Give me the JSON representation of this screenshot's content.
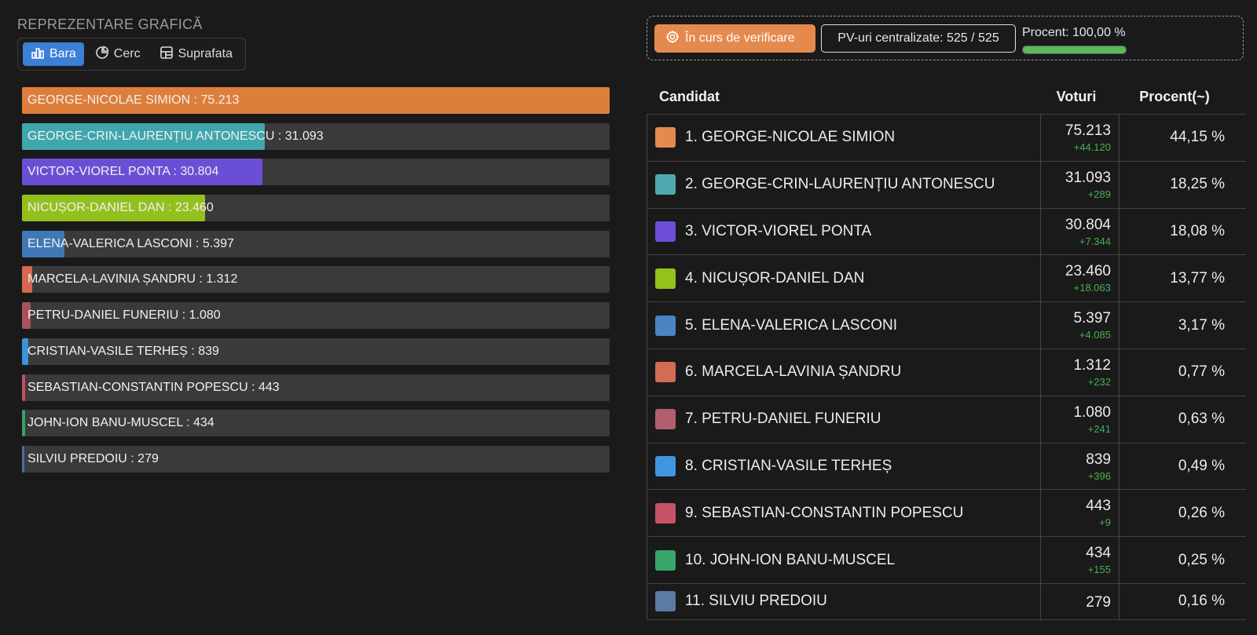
{
  "chart_section": {
    "title": "REPREZENTARE GRAFICĂ",
    "toggle": [
      {
        "label": "Bara",
        "icon": "bar-chart-icon",
        "active": true
      },
      {
        "label": "Cerc",
        "icon": "pie-chart-icon",
        "active": false
      },
      {
        "label": "Suprafata",
        "icon": "treemap-icon",
        "active": false
      }
    ]
  },
  "status": {
    "button_label": "În curs de verificare",
    "pv_label": "PV-uri centralizate: 525 / 525",
    "percent_label": "Procent: 100,00 %",
    "percent_value": 100,
    "accent_color": "#e48a4d",
    "progress_color": "#5cb85c"
  },
  "table": {
    "headers": {
      "candidate": "Candidat",
      "votes": "Voturi",
      "percent": "Procent(~)"
    }
  },
  "chart_data": {
    "type": "bar",
    "orientation": "horizontal",
    "xlim": [
      0,
      75213
    ],
    "categories": [
      "GEORGE-NICOLAE SIMION",
      "GEORGE-CRIN-LAURENȚIU ANTONESCU",
      "VICTOR-VIOREL PONTA",
      "NICUȘOR-DANIEL DAN",
      "ELENA-VALERICA LASCONI",
      "MARCELA-LAVINIA ȘANDRU",
      "PETRU-DANIEL FUNERIU",
      "CRISTIAN-VASILE TERHEȘ",
      "SEBASTIAN-CONSTANTIN POPESCU",
      "JOHN-ION BANU-MUSCEL",
      "SILVIU PREDOIU"
    ],
    "values": [
      75213,
      31093,
      30804,
      23460,
      5397,
      1312,
      1080,
      839,
      443,
      434,
      279
    ],
    "bar_labels": [
      "GEORGE-NICOLAE SIMION : 75.213",
      "GEORGE-CRIN-LAURENȚIU ANTONESCU : 31.093",
      "VICTOR-VIOREL PONTA : 30.804",
      "NICUȘOR-DANIEL DAN : 23.460",
      "ELENA-VALERICA LASCONI : 5.397",
      "MARCELA-LAVINIA ȘANDRU : 1.312",
      "PETRU-DANIEL FUNERIU : 1.080",
      "CRISTIAN-VASILE TERHEȘ : 839",
      "SEBASTIAN-CONSTANTIN POPESCU : 443",
      "JOHN-ION BANU-MUSCEL : 434",
      "SILVIU PREDOIU : 279"
    ],
    "colors": [
      "#dd7e3b",
      "#40a6ad",
      "#6a4fd6",
      "#93c01f",
      "#3f79b5",
      "#d5694f",
      "#a8525e",
      "#3d93d9",
      "#c24f62",
      "#38a067",
      "#4f6f98"
    ]
  },
  "candidates": [
    {
      "name": "1. GEORGE-NICOLAE SIMION",
      "votes": "75.213",
      "delta": "+44.120",
      "percent": "44,15 %",
      "color": "#e48a4d"
    },
    {
      "name": "2. GEORGE-CRIN-LAURENȚIU ANTONESCU",
      "votes": "31.093",
      "delta": "+289",
      "percent": "18,25 %",
      "color": "#4fa8b1"
    },
    {
      "name": "3. VICTOR-VIOREL PONTA",
      "votes": "30.804",
      "delta": "+7.344",
      "percent": "18,08 %",
      "color": "#6d4fd8"
    },
    {
      "name": "4. NICUȘOR-DANIEL DAN",
      "votes": "23.460",
      "delta": "+18.063",
      "percent": "13,77 %",
      "color": "#94c11c"
    },
    {
      "name": "5. ELENA-VALERICA LASCONI",
      "votes": "5.397",
      "delta": "+4.085",
      "percent": "3,17 %",
      "color": "#4a84c2"
    },
    {
      "name": "6. MARCELA-LAVINIA ȘANDRU",
      "votes": "1.312",
      "delta": "+232",
      "percent": "0,77 %",
      "color": "#d46b53"
    },
    {
      "name": "7. PETRU-DANIEL FUNERIU",
      "votes": "1.080",
      "delta": "+241",
      "percent": "0,63 %",
      "color": "#b0606d"
    },
    {
      "name": "8. CRISTIAN-VASILE TERHEȘ",
      "votes": "839",
      "delta": "+396",
      "percent": "0,49 %",
      "color": "#3f96e0"
    },
    {
      "name": "9. SEBASTIAN-CONSTANTIN POPESCU",
      "votes": "443",
      "delta": "+9",
      "percent": "0,26 %",
      "color": "#c45367"
    },
    {
      "name": "10. JOHN-ION BANU-MUSCEL",
      "votes": "434",
      "delta": "+155",
      "percent": "0,25 %",
      "color": "#3aa56b"
    },
    {
      "name": "11. SILVIU PREDOIU",
      "votes": "279",
      "delta": "",
      "percent": "0,16 %",
      "color": "#5a7ba3"
    }
  ]
}
